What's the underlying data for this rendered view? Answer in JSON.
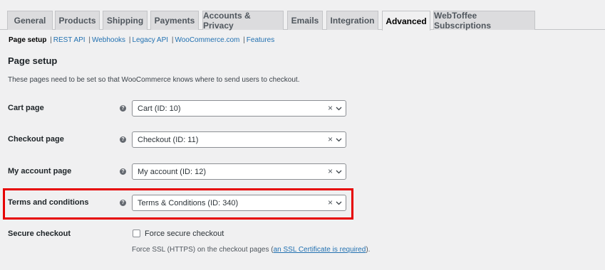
{
  "tabs": [
    {
      "label": "General"
    },
    {
      "label": "Products"
    },
    {
      "label": "Shipping"
    },
    {
      "label": "Payments"
    },
    {
      "label": "Accounts & Privacy"
    },
    {
      "label": "Emails"
    },
    {
      "label": "Integration"
    },
    {
      "label": "Advanced",
      "active": true
    },
    {
      "label": "WebToffee Subscriptions"
    }
  ],
  "subnav": {
    "current": "Page setup",
    "links": [
      "REST API",
      "Webhooks",
      "Legacy API",
      "WooCommerce.com",
      "Features"
    ],
    "separator": "|"
  },
  "section": {
    "title": "Page setup",
    "description": "These pages need to be set so that WooCommerce knows where to send users to checkout."
  },
  "fields": [
    {
      "label": "Cart page",
      "value": "Cart (ID: 10)"
    },
    {
      "label": "Checkout page",
      "value": "Checkout (ID: 11)"
    },
    {
      "label": "My account page",
      "value": "My account (ID: 12)"
    },
    {
      "label": "Terms and conditions",
      "value": "Terms & Conditions (ID: 340)"
    }
  ],
  "help_glyph": "?",
  "clear_glyph": "×",
  "secure": {
    "label": "Secure checkout",
    "checkbox_label": "Force secure checkout",
    "checked": false,
    "note_prefix": "Force SSL (HTTPS) on the checkout pages (",
    "note_link": "an SSL Certificate is required",
    "note_suffix": ")."
  },
  "colors": {
    "link": "#2271b1",
    "highlight": "#e60000",
    "background": "#f0f0f1"
  }
}
